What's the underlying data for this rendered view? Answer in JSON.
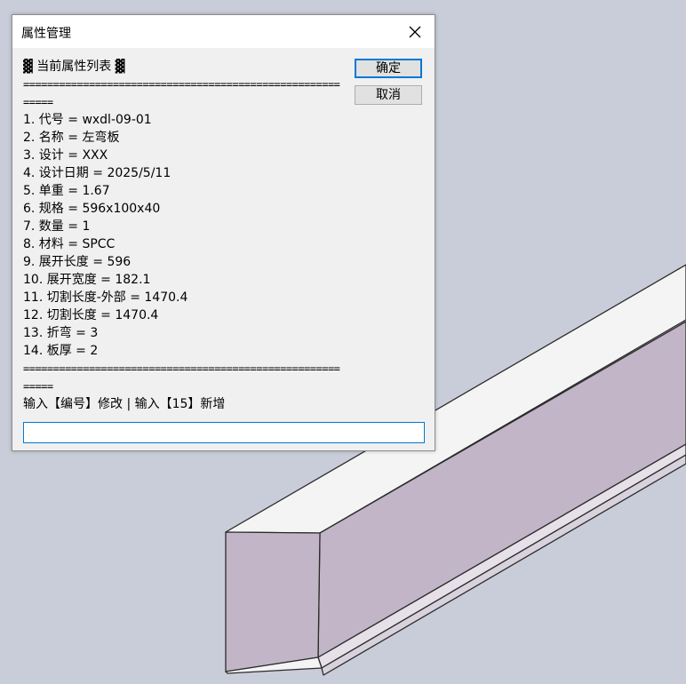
{
  "dialog": {
    "title": "属性管理",
    "header": "▓ 当前属性列表 ▓",
    "separator": "==========================================================",
    "properties": [
      "1. 代号 = wxdl-09-01",
      "2. 名称 = 左弯板",
      "3. 设计 = XXX",
      "4. 设计日期 = 2025/5/11",
      "5. 单重 = 1.67",
      "6. 规格 = 596x100x40",
      "7. 数量 = 1",
      "8. 材料 = SPCC",
      "9. 展开长度 = 596",
      "10. 展开宽度 = 182.1",
      "11. 切割长度-外部 = 1470.4",
      "12. 切割长度 = 1470.4",
      "13. 折弯 = 3",
      "14. 板厚 = 2"
    ],
    "prompt": "输入【编号】修改 | 输入【15】新增",
    "ok_label": "确定",
    "cancel_label": "取消",
    "input_value": ""
  },
  "colors": {
    "background": "#c9cdd9",
    "part_face_light": "#ffffff",
    "part_face_shaded": "#c2b5c7",
    "accent": "#0078d7"
  }
}
